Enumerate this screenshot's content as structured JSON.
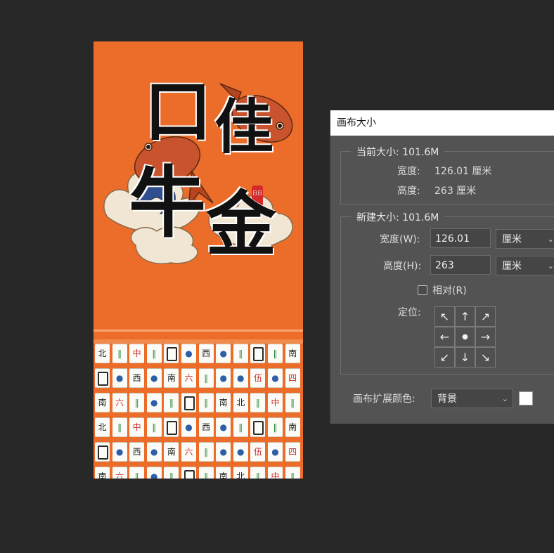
{
  "poster": {
    "title_chars": [
      "口",
      "佳",
      "牛",
      "金"
    ],
    "seal_text": "日日",
    "tile_rows": [
      [
        "北",
        "‖",
        "中",
        "‖",
        "▢",
        "●",
        "西",
        "●",
        "‖",
        "▢",
        "‖",
        "南"
      ],
      [
        "▢",
        "●",
        "西",
        "●",
        "南",
        "六",
        "‖",
        "●",
        "●",
        "伍",
        "●",
        "四"
      ],
      [
        "南",
        "六",
        "‖",
        "●",
        "‖",
        "▢",
        "‖",
        "南",
        "北",
        "‖",
        "中",
        "‖"
      ],
      [
        "北",
        "‖",
        "中",
        "‖",
        "▢",
        "●",
        "西",
        "●",
        "‖",
        "▢",
        "‖",
        "南"
      ],
      [
        "▢",
        "●",
        "西",
        "●",
        "南",
        "六",
        "‖",
        "●",
        "●",
        "伍",
        "●",
        "四"
      ],
      [
        "南",
        "六",
        "‖",
        "●",
        "‖",
        "▢",
        "‖",
        "南",
        "北",
        "‖",
        "中",
        "‖"
      ]
    ]
  },
  "dialog": {
    "title": "画布大小",
    "current": {
      "legend": "当前大小: 101.6M",
      "width_label": "宽度:",
      "width_value": "126.01 厘米",
      "height_label": "高度:",
      "height_value": "263 厘米"
    },
    "new": {
      "legend": "新建大小: 101.6M",
      "width_label": "宽度(W):",
      "width_value": "126.01",
      "width_unit": "厘米",
      "height_label": "高度(H):",
      "height_value": "263",
      "height_unit": "厘米",
      "relative_label": "相对(R)",
      "relative_checked": false,
      "anchor_label": "定位:",
      "anchor_arrows": [
        "↖",
        "↑",
        "↗",
        "←",
        "●",
        "→",
        "↙",
        "↓",
        "↘"
      ]
    },
    "extension": {
      "label": "画布扩展颜色:",
      "value": "背景",
      "swatch_color": "#ffffff"
    }
  },
  "colors": {
    "workspace": "#282828",
    "poster_orange": "#ec6d2a",
    "dialog_bg": "#535353"
  }
}
